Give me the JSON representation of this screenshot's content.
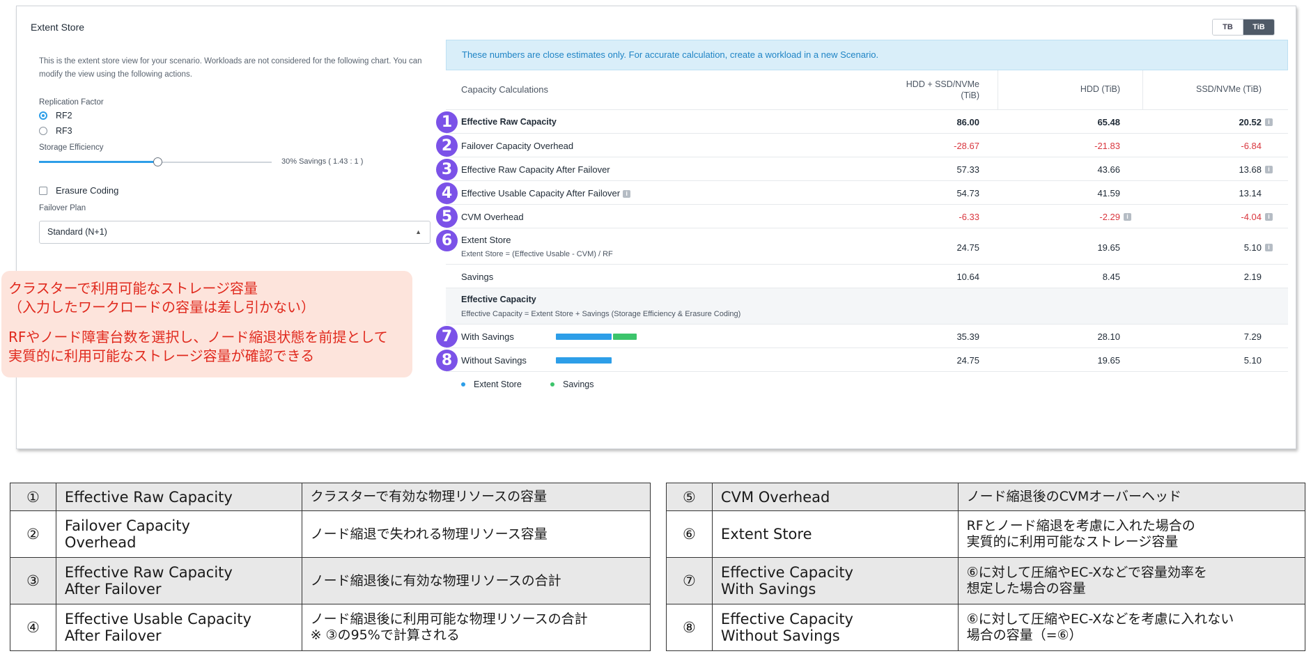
{
  "panel": {
    "title": "Extent Store",
    "units": {
      "tb": "TB",
      "tib": "TiB",
      "selected": "TiB"
    },
    "description": "This is the extent store view for your scenario. Workloads are not considered for the following chart. You can modify the view using the following actions.",
    "replication_factor": {
      "label": "Replication Factor",
      "options": [
        "RF2",
        "RF3"
      ],
      "selected": "RF2"
    },
    "storage_efficiency": {
      "label": "Storage Efficiency",
      "value_text": "30% Savings ( 1.43 : 1 )",
      "slider_fraction": 0.51
    },
    "erasure_coding": {
      "label": "Erasure Coding",
      "checked": false
    },
    "failover_plan": {
      "label": "Failover Plan",
      "value": "Standard (N+1)"
    }
  },
  "notice": "These numbers are close estimates only. For accurate calculation, create a workload in a new Scenario.",
  "table": {
    "header": {
      "name": "Capacity Calculations",
      "col1_a": "HDD + SSD/NVMe",
      "col1_b": "(TiB)",
      "col2": "HDD (TiB)",
      "col3": "SSD/NVMe (TiB)"
    },
    "rows": [
      {
        "badge": "1",
        "name": "Effective Raw Capacity",
        "v1": "86.00",
        "v2": "65.48",
        "v3": "20.52"
      },
      {
        "badge": "2",
        "name": "Failover Capacity Overhead",
        "v1": "-28.67",
        "v2": "-21.83",
        "v3": "-6.84"
      },
      {
        "badge": "3",
        "name": "Effective Raw Capacity After Failover",
        "v1": "57.33",
        "v2": "43.66",
        "v3": "13.68"
      },
      {
        "badge": "4",
        "name": "Effective Usable Capacity After Failover",
        "v1": "54.73",
        "v2": "41.59",
        "v3": "13.14"
      },
      {
        "badge": "5",
        "name": "CVM Overhead",
        "v1": "-6.33",
        "v2": "-2.29",
        "v3": "-4.04"
      },
      {
        "badge": "6",
        "name": "Extent Store",
        "formula": "Extent Store = (Effective Usable - CVM) / RF",
        "v1": "24.75",
        "v2": "19.65",
        "v3": "5.10"
      },
      {
        "name": "Savings",
        "v1": "10.64",
        "v2": "8.45",
        "v3": "2.19"
      },
      {
        "name": "Effective Capacity",
        "formula": "Effective Capacity = Extent Store + Savings (Storage Efficiency & Erasure Coding)"
      },
      {
        "badge": "7",
        "name": "With Savings",
        "v1": "35.39",
        "v2": "28.10",
        "v3": "7.29",
        "bar_extent": 24.75,
        "bar_savings": 10.64
      },
      {
        "badge": "8",
        "name": "Without Savings",
        "v1": "24.75",
        "v2": "19.65",
        "v3": "5.10",
        "bar_extent": 24.75,
        "bar_savings": 0
      }
    ],
    "legend": {
      "extent": "Extent Store",
      "savings": "Savings"
    },
    "colors": {
      "extent": "#2d9ee8",
      "savings": "#3cc46b",
      "negative": "#d9363e",
      "badge": "#7b52e8"
    }
  },
  "callout": {
    "line1": "クラスターで利用可能なストレージ容量",
    "line2": "（入力したワークロードの容量は差し引かない）",
    "line3": "RFやノード障害台数を選択し、ノード縮退状態を前提として",
    "line4": "実質的に利用可能なストレージ容量が確認できる"
  },
  "legend_left": [
    {
      "num": "①",
      "term": "Effective Raw Capacity",
      "desc": "クラスターで有効な物理リソースの容量"
    },
    {
      "num": "②",
      "term_a": "Failover Capacity",
      "term_b": "Overhead",
      "desc": "ノード縮退で失われる物理リソース容量"
    },
    {
      "num": "③",
      "term_a": "Effective Raw Capacity",
      "term_b": "After Failover",
      "desc": "ノード縮退後に有効な物理リソースの合計"
    },
    {
      "num": "④",
      "term_a": "Effective Usable Capacity",
      "term_b": "After Failover",
      "desc_a": "ノード縮退後に利用可能な物理リソースの合計",
      "desc_b": "※ ③の95%で計算される"
    }
  ],
  "legend_right": [
    {
      "num": "⑤",
      "term": "CVM Overhead",
      "desc": "ノード縮退後のCVMオーバーヘッド"
    },
    {
      "num": "⑥",
      "term": "Extent Store",
      "desc_a": "RFとノード縮退を考慮に入れた場合の",
      "desc_b": "実質的に利用可能なストレージ容量"
    },
    {
      "num": "⑦",
      "term_a": "Effective Capacity",
      "term_b": "With Savings",
      "desc_a": "⑥に対して圧縮やEC-Xなどで容量効率を",
      "desc_b": "想定した場合の容量"
    },
    {
      "num": "⑧",
      "term_a": "Effective Capacity",
      "term_b": "Without Savings",
      "desc_a": "⑥に対して圧縮やEC-Xなどを考慮に入れない",
      "desc_b": "場合の容量（=⑥）"
    }
  ]
}
